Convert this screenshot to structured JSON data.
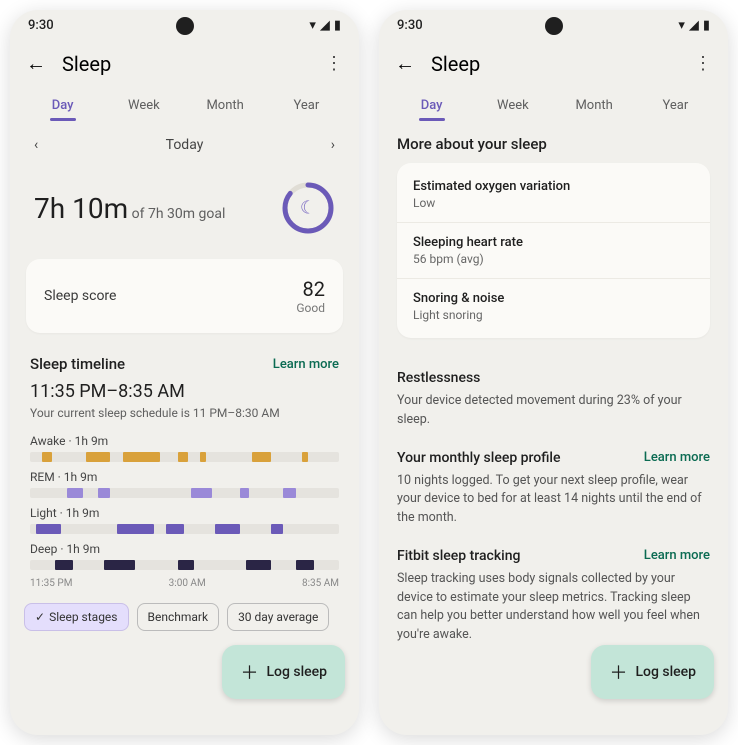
{
  "status": {
    "time": "9:30"
  },
  "header": {
    "title": "Sleep"
  },
  "tabs": [
    "Day",
    "Week",
    "Month",
    "Year"
  ],
  "dateNav": {
    "label": "Today"
  },
  "duration": {
    "hours": "7",
    "minutes": "10",
    "goal": "of 7h 30m goal"
  },
  "scoreCard": {
    "label": "Sleep score",
    "value": "82",
    "rating": "Good"
  },
  "timeline": {
    "title": "Sleep timeline",
    "learnMore": "Learn more",
    "range": "11:35 PM–8:35 AM",
    "schedule": "Your current sleep schedule is 11 PM–8:30 AM",
    "stages": {
      "Awake": "1h 9m",
      "REM": "1h 9m",
      "Light": "1h 9m",
      "Deep": "1h 9m"
    },
    "axis": [
      "11:35 PM",
      "3:00 AM",
      "8:35 AM"
    ]
  },
  "chart_data": {
    "type": "table",
    "title": "Sleep stages timeline",
    "rows": [
      {
        "stage": "Awake",
        "duration": "1h 9m",
        "color": "#d9a13b"
      },
      {
        "stage": "REM",
        "duration": "1h 9m",
        "color": "#9a89d8"
      },
      {
        "stage": "Light",
        "duration": "1h 9m",
        "color": "#6b5ab8"
      },
      {
        "stage": "Deep",
        "duration": "1h 9m",
        "color": "#2a2545"
      }
    ],
    "time_range": [
      "11:35 PM",
      "8:35 AM"
    ]
  },
  "chips": {
    "stages": "Sleep stages",
    "benchmark": "Benchmark",
    "avg": "30 day average"
  },
  "fab": {
    "label": "Log sleep"
  },
  "more": {
    "title": "More about your sleep",
    "rows": [
      {
        "t": "Estimated oxygen variation",
        "v": "Low"
      },
      {
        "t": "Sleeping heart rate",
        "v": "56 bpm (avg)"
      },
      {
        "t": "Snoring & noise",
        "v": "Light snoring"
      }
    ],
    "restlessness": {
      "t": "Restlessness",
      "text": "Your device detected movement during 23% of your sleep."
    },
    "monthly": {
      "t": "Your monthly sleep profile",
      "link": "Learn more",
      "text": "10 nights logged. To get your next sleep profile, wear your device to bed for at least 14 nights until the end of the month."
    },
    "fitbit": {
      "t": "Fitbit sleep tracking",
      "link": "Learn more",
      "text": "Sleep tracking uses body signals collected by your device to estimate your sleep metrics. Tracking sleep can help you better understand how well you feel when you're awake."
    }
  }
}
